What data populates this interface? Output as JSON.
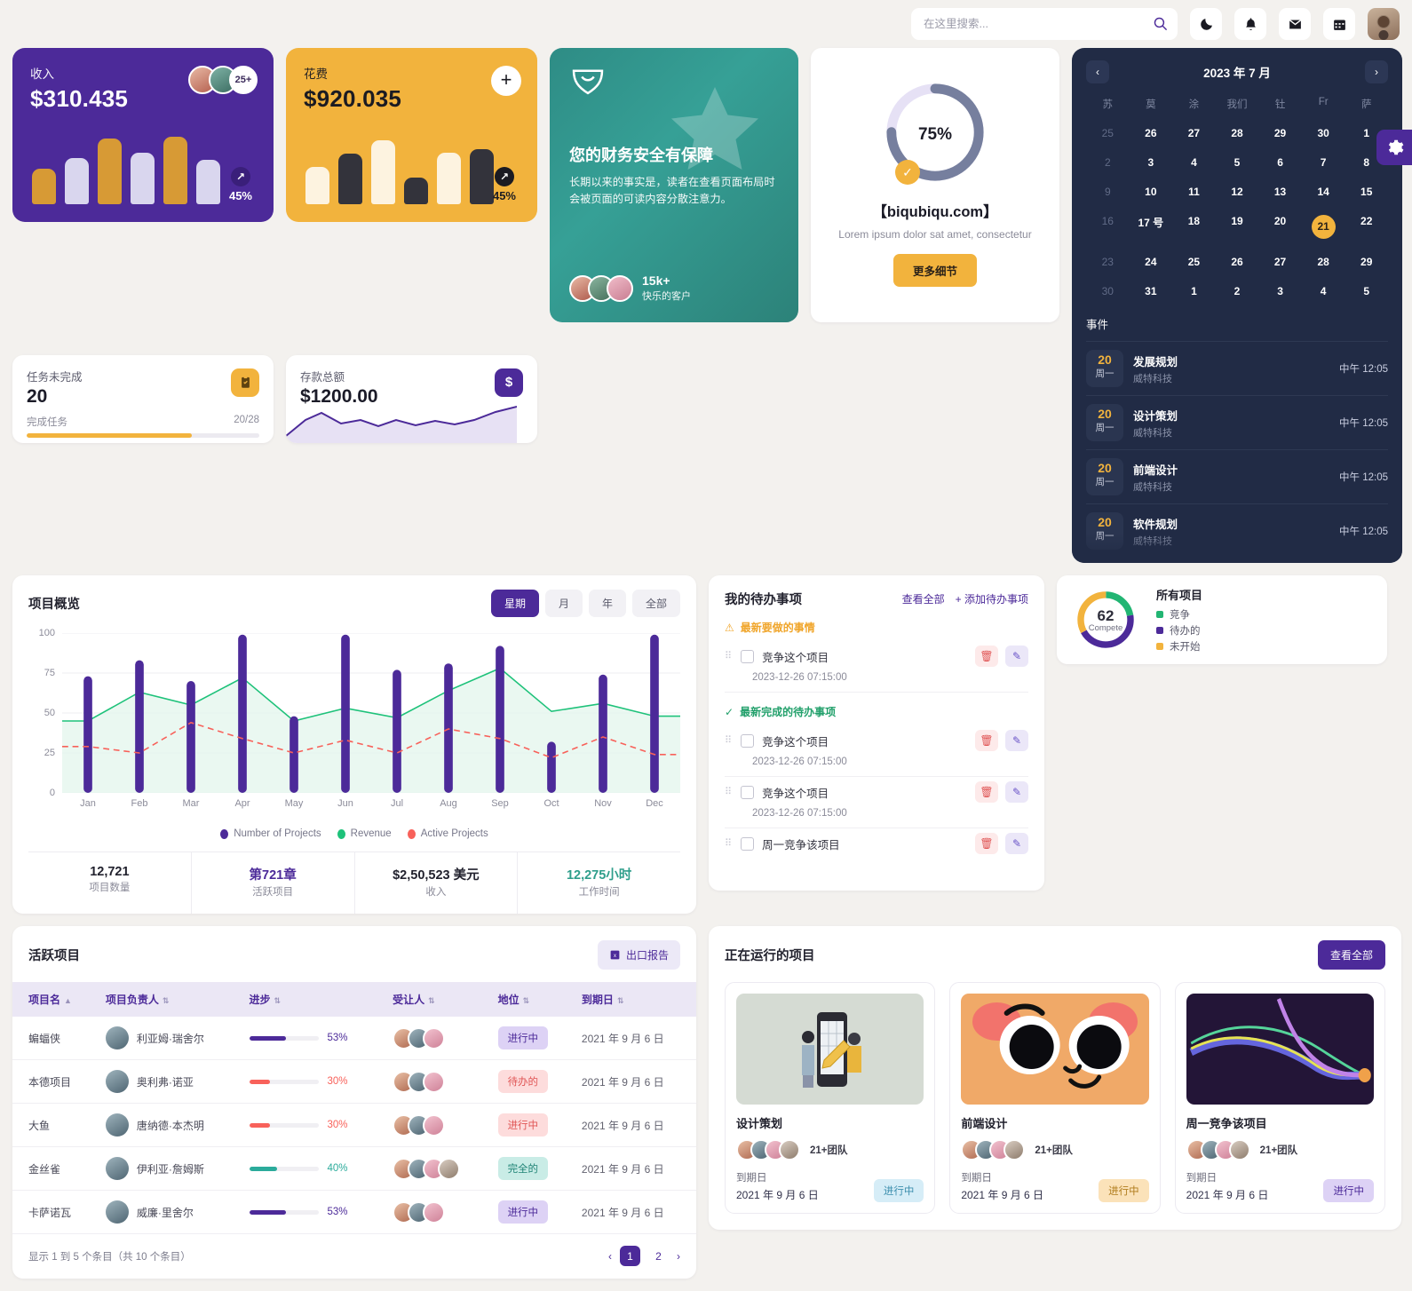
{
  "header": {
    "search": {
      "placeholder": "在这里搜索...",
      "value": ""
    },
    "icons": [
      "moon-icon",
      "bell-icon",
      "mail-icon",
      "calendar-icon"
    ],
    "avatar": "user-avatar"
  },
  "kpi": {
    "income": {
      "label": "收入",
      "value": "$310.435",
      "badge": "45%",
      "more": "25+",
      "bars": [
        40,
        52,
        74,
        58,
        76,
        50
      ],
      "colors": [
        "#d79a35",
        "#d9d6ee",
        "#d79a35",
        "#d9d6ee",
        "#d79a35",
        "#d9d6ee"
      ]
    },
    "expense": {
      "label": "花费",
      "value": "$920.035",
      "badge": "45%",
      "bars": [
        42,
        57,
        72,
        30,
        58,
        62
      ],
      "colors": [
        "#fdf3e0",
        "#33333b",
        "#fdf3e0",
        "#33333b",
        "#fdf3e0",
        "#33333b"
      ]
    }
  },
  "tasks": {
    "title": "任务未完成",
    "count": "20",
    "foot_label": "完成任务",
    "foot_ratio": "20/28",
    "progress": 71,
    "icon": "clipboard-icon"
  },
  "deposit": {
    "title": "存款总额",
    "value": "$1200.00",
    "icon": "dollar-icon"
  },
  "promo": {
    "title": "您的财务安全有保障",
    "body": "长期以来的事实是，读者在查看页面布局时会被页面的可读内容分散注意力。",
    "count": "15k+",
    "count_label": "快乐的客户",
    "logo": "shield-leaf-icon"
  },
  "ring": {
    "percent": "75%",
    "percent_value": 75,
    "site": "【biqubiqu.com】",
    "desc": "Lorem ipsum dolor sat amet, consectetur",
    "button": "更多细节",
    "check": "check-icon"
  },
  "calendar": {
    "title": "2023 年 7 月",
    "prev": "chevron-left-icon",
    "next": "chevron-right-icon",
    "dow": [
      "苏",
      "莫",
      "涂",
      "我们",
      "钍",
      "Fr",
      "萨"
    ],
    "weeks": [
      [
        {
          "d": "25",
          "mute": true
        },
        {
          "d": "26"
        },
        {
          "d": "27"
        },
        {
          "d": "28"
        },
        {
          "d": "29"
        },
        {
          "d": "30"
        },
        {
          "d": "1"
        }
      ],
      [
        {
          "d": "2",
          "mute": true
        },
        {
          "d": "3"
        },
        {
          "d": "4"
        },
        {
          "d": "5"
        },
        {
          "d": "6"
        },
        {
          "d": "7"
        },
        {
          "d": "8"
        }
      ],
      [
        {
          "d": "9",
          "mute": true
        },
        {
          "d": "10"
        },
        {
          "d": "11"
        },
        {
          "d": "12"
        },
        {
          "d": "13"
        },
        {
          "d": "14"
        },
        {
          "d": "15"
        }
      ],
      [
        {
          "d": "16",
          "mute": true
        },
        {
          "d": "17 号"
        },
        {
          "d": "18"
        },
        {
          "d": "19"
        },
        {
          "d": "20"
        },
        {
          "d": "21",
          "sel": true
        },
        {
          "d": "22"
        }
      ],
      [
        {
          "d": "23",
          "mute": true
        },
        {
          "d": "24"
        },
        {
          "d": "25"
        },
        {
          "d": "26"
        },
        {
          "d": "27"
        },
        {
          "d": "28"
        },
        {
          "d": "29"
        }
      ],
      [
        {
          "d": "30",
          "mute": true
        },
        {
          "d": "31"
        },
        {
          "d": "1"
        },
        {
          "d": "2"
        },
        {
          "d": "3"
        },
        {
          "d": "4"
        },
        {
          "d": "5"
        }
      ]
    ],
    "events_title": "事件",
    "events": [
      {
        "day": "20",
        "weekday": "周一",
        "name": "发展规划",
        "org": "威特科技",
        "time": "中午 12:05"
      },
      {
        "day": "20",
        "weekday": "周一",
        "name": "设计策划",
        "org": "威特科技",
        "time": "中午 12:05"
      },
      {
        "day": "20",
        "weekday": "周一",
        "name": "前端设计",
        "org": "威特科技",
        "time": "中午 12:05"
      },
      {
        "day": "20",
        "weekday": "周一",
        "name": "软件规划",
        "org": "威特科技",
        "time": "中午 12:05"
      }
    ]
  },
  "settings_tab": {
    "icon": "gear-icon"
  },
  "overview": {
    "title": "项目概览",
    "filters": [
      {
        "label": "星期",
        "active": true
      },
      {
        "label": "月",
        "active": false
      },
      {
        "label": "年",
        "active": false
      },
      {
        "label": "全部",
        "active": false
      }
    ],
    "stats": [
      {
        "value": "12,721",
        "label": "项目数量",
        "color": "#22222e"
      },
      {
        "value": "第721章",
        "label": "活跃项目",
        "color": "#4c2a99"
      },
      {
        "value": "$2,50,523 美元",
        "label": "收入",
        "color": "#22222e"
      },
      {
        "value": "12,275小时",
        "label": "工作时间",
        "color": "#2e9e8b"
      }
    ]
  },
  "chart_data": {
    "type": "bar",
    "title": "项目概览",
    "categories": [
      "Jan",
      "Feb",
      "Mar",
      "Apr",
      "May",
      "Jun",
      "Jul",
      "Aug",
      "Sep",
      "Oct",
      "Nov",
      "Dec"
    ],
    "xlabel": "",
    "ylabel": "",
    "ylim": [
      0,
      100
    ],
    "yticks": [
      0,
      25,
      50,
      75,
      100
    ],
    "grid": true,
    "legend_position": "bottom",
    "series": [
      {
        "name": "Number of Projects",
        "type": "bar",
        "color": "#4c2a99",
        "values": [
          73,
          83,
          70,
          99,
          48,
          99,
          77,
          81,
          92,
          32,
          74,
          99
        ]
      },
      {
        "name": "Revenue",
        "type": "area",
        "color": "#1ec27a",
        "values": [
          45,
          63,
          55,
          72,
          45,
          53,
          47,
          64,
          78,
          51,
          56,
          48
        ]
      },
      {
        "name": "Active Projects",
        "type": "line-dashed",
        "color": "#f8615a",
        "values": [
          29,
          25,
          44,
          34,
          25,
          33,
          25,
          40,
          34,
          22,
          35,
          24
        ]
      }
    ]
  },
  "todo": {
    "title": "我的待办事项",
    "view_all": "查看全部",
    "add": "+ 添加待办事项",
    "group_pending": "最新要做的事情",
    "group_done": "最新完成的待办事项",
    "items": [
      {
        "text": "竞争这个项目",
        "time": "2023-12-26 07:15:00",
        "group": "pending"
      },
      {
        "text": "竞争这个项目",
        "time": "2023-12-26 07:15:00",
        "group": "done"
      },
      {
        "text": "竞争这个项目",
        "time": "2023-12-26 07:15:00",
        "group": ""
      },
      {
        "text": "周一竞争该项目",
        "time": "",
        "group": ""
      }
    ],
    "delete_icon": "trash-icon",
    "edit_icon": "pencil-icon"
  },
  "all_projects": {
    "chart_data": {
      "type": "pie",
      "title": "所有项目",
      "center_value": "62",
      "center_label": "Compete",
      "labels": [
        "竞争",
        "待办的",
        "未开始"
      ],
      "values": [
        22,
        45,
        33
      ],
      "colors": [
        "#22b573",
        "#4c2a99",
        "#f2b33d"
      ]
    }
  },
  "table": {
    "title": "活跃项目",
    "export": "出口报告",
    "export_icon": "excel-icon",
    "columns": [
      "项目名",
      "项目负责人",
      "进步",
      "受让人",
      "地位",
      "到期日"
    ],
    "rows": [
      {
        "name": "蝙蝠侠",
        "owner": "利亚姆·瑞舍尔",
        "pct": "53%",
        "pval": 53,
        "pcolor": "#4c2a99",
        "team": 3,
        "status": "进行中",
        "status_bg": "#ddd2f5",
        "status_fg": "#4c2a99",
        "due": "2021 年 9 月 6 日"
      },
      {
        "name": "本德项目",
        "owner": "奥利弗·诺亚",
        "pct": "30%",
        "pval": 30,
        "pcolor": "#f8615a",
        "team": 3,
        "status": "待办的",
        "status_bg": "#fddcdc",
        "status_fg": "#e05555",
        "due": "2021 年 9 月 6 日"
      },
      {
        "name": "大鱼",
        "owner": "唐纳德·本杰明",
        "pct": "30%",
        "pval": 30,
        "pcolor": "#f8615a",
        "team": 3,
        "status": "进行中",
        "status_bg": "#fddcdc",
        "status_fg": "#e05555",
        "due": "2021 年 9 月 6 日"
      },
      {
        "name": "金丝雀",
        "owner": "伊利亚·詹姆斯",
        "pct": "40%",
        "pval": 40,
        "pcolor": "#2bab9b",
        "team": 4,
        "status": "完全的",
        "status_bg": "#c9ece6",
        "status_fg": "#1f8375",
        "due": "2021 年 9 月 6 日"
      },
      {
        "name": "卡萨诺瓦",
        "owner": "威廉·里舍尔",
        "pct": "53%",
        "pval": 53,
        "pcolor": "#4c2a99",
        "team": 3,
        "status": "进行中",
        "status_bg": "#ddd2f5",
        "status_fg": "#4c2a99",
        "due": "2021 年 9 月 6 日"
      }
    ],
    "info": "显示 1 到 5 个条目（共 10 个条目）",
    "pager": {
      "prev": "‹",
      "pages": [
        "1",
        "2"
      ],
      "current": "1",
      "next": "›"
    }
  },
  "running": {
    "title": "正在运行的项目",
    "view_all": "查看全部",
    "cards": [
      {
        "name": "设计策划",
        "team_label": "21+团队",
        "due_label": "到期日",
        "due": "2021 年 9 月 6 日",
        "status": "进行中",
        "status_bg": "#d6edf7",
        "status_fg": "#3d8fae",
        "thumb": "design-illustration"
      },
      {
        "name": "前端设计",
        "team_label": "21+团队",
        "due_label": "到期日",
        "due": "2021 年 9 月 6 日",
        "status": "进行中",
        "status_bg": "#fbe2b9",
        "status_fg": "#b07c1c",
        "thumb": "cat-illustration"
      },
      {
        "name": "周一竞争该项目",
        "team_label": "21+团队",
        "due_label": "到期日",
        "due": "2021 年 9 月 6 日",
        "status": "进行中",
        "status_bg": "#ddd2f5",
        "status_fg": "#4c2a99",
        "thumb": "wave-chart"
      }
    ]
  }
}
